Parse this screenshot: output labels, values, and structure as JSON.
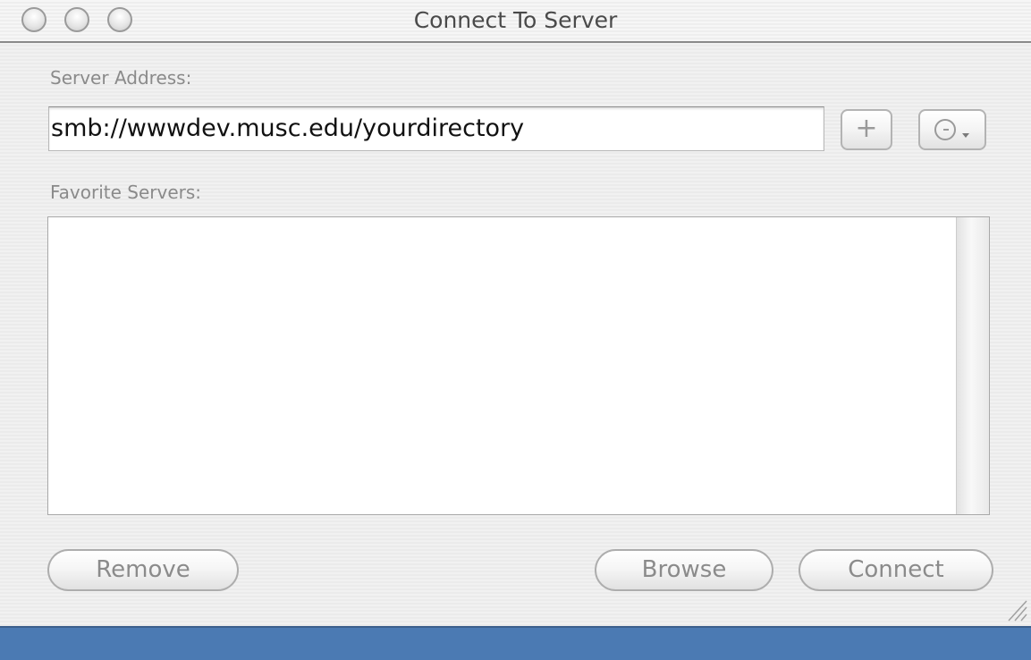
{
  "window": {
    "title": "Connect To Server"
  },
  "server_address": {
    "label": "Server Address:",
    "value": "smb://wwwdev.musc.edu/yourdirectory",
    "add_button_label": "+"
  },
  "favorites": {
    "label": "Favorite Servers:",
    "items": []
  },
  "buttons": {
    "remove": "Remove",
    "browse": "Browse",
    "connect": "Connect"
  },
  "icons": {
    "recent_servers": "clock-icon",
    "recent_caret": "chevron-down-icon",
    "resize": "resize-grip-icon"
  },
  "colors": {
    "desktop": "#4b7ab3",
    "window_background": "#eeeeee"
  }
}
